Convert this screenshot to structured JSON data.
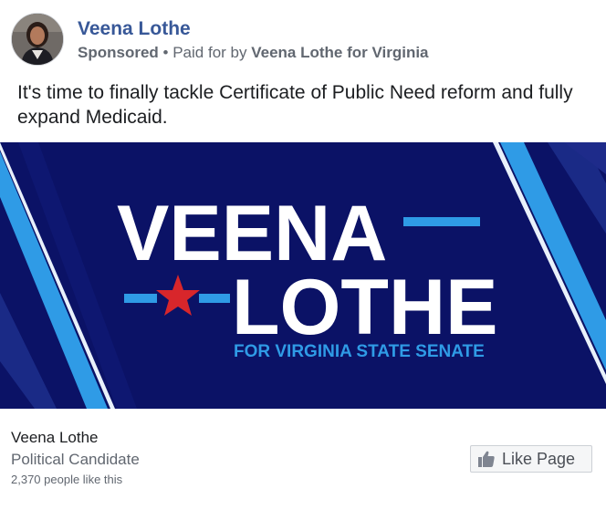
{
  "header": {
    "page_name": "Veena Lothe",
    "sponsored_label": "Sponsored",
    "separator": "•",
    "paid_for_prefix": "Paid for by",
    "paid_for_by": "Veena Lothe for Virginia"
  },
  "post": {
    "text": "It's time to finally tackle Certificate of Public Need reform and fully expand Medicaid."
  },
  "ad_image": {
    "line1": "VEENA",
    "line2": "LOTHE",
    "tagline": "FOR VIRGINIA STATE SENATE",
    "colors": {
      "background": "#0b1266",
      "text": "#ffffff",
      "accent": "#2f9be6",
      "star": "#d8262b"
    }
  },
  "footer": {
    "page_name": "Veena Lothe",
    "category": "Political Candidate",
    "likes": "2,370 people like this",
    "like_button_label": "Like Page"
  },
  "icons": {
    "avatar": "candidate-avatar",
    "star": "star-icon",
    "like": "thumbs-up-icon"
  }
}
